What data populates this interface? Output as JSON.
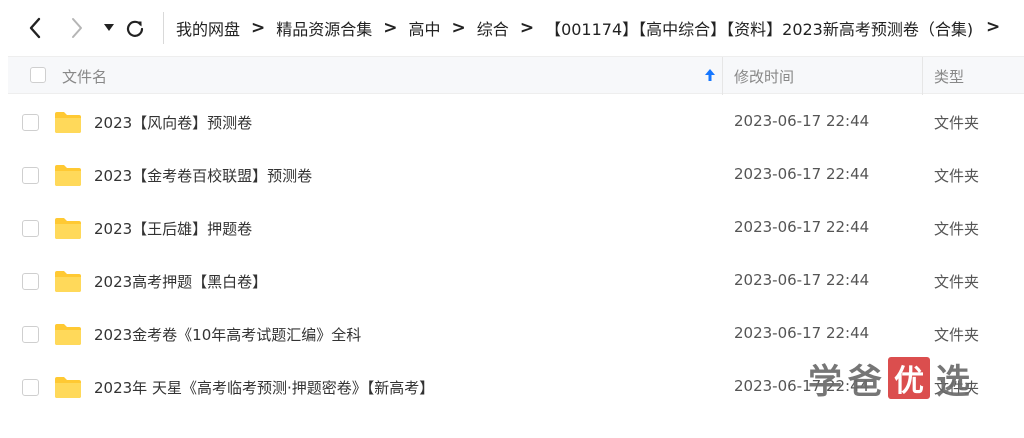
{
  "toolbar": {
    "back_icon": "chevron-left-icon",
    "forward_icon": "chevron-right-icon",
    "dropdown_icon": "triangle-down-icon",
    "refresh_icon": "refresh-icon"
  },
  "breadcrumb": [
    "我的网盘",
    "精品资源合集",
    "高中",
    "综合",
    "【001174】【高中综合】【资料】2023新高考预测卷（合集)"
  ],
  "breadcrumb_separator": ">",
  "header": {
    "name": "文件名",
    "time": "修改时间",
    "type": "类型",
    "sort_icon": "sort-up-arrow-icon",
    "sort_color": "#1677ff"
  },
  "files": [
    {
      "name": "2023【风向卷】预测卷",
      "time": "2023-06-17 22:44",
      "type": "文件夹"
    },
    {
      "name": "2023【金考卷百校联盟】预测卷",
      "time": "2023-06-17 22:44",
      "type": "文件夹"
    },
    {
      "name": "2023【王后雄】押题卷",
      "time": "2023-06-17 22:44",
      "type": "文件夹"
    },
    {
      "name": "2023高考押题【黑白卷】",
      "time": "2023-06-17 22:44",
      "type": "文件夹"
    },
    {
      "name": "2023金考卷《10年高考试题汇编》全科",
      "time": "2023-06-17 22:44",
      "type": "文件夹"
    },
    {
      "name": "2023年 天星《高考临考预测·押题密卷》【新高考】",
      "time": "2023-06-17 22:44",
      "type": "文件夹"
    }
  ],
  "folder_color": "#ffc933",
  "watermark": {
    "chars": [
      "学",
      "爸",
      "优",
      "选"
    ]
  }
}
